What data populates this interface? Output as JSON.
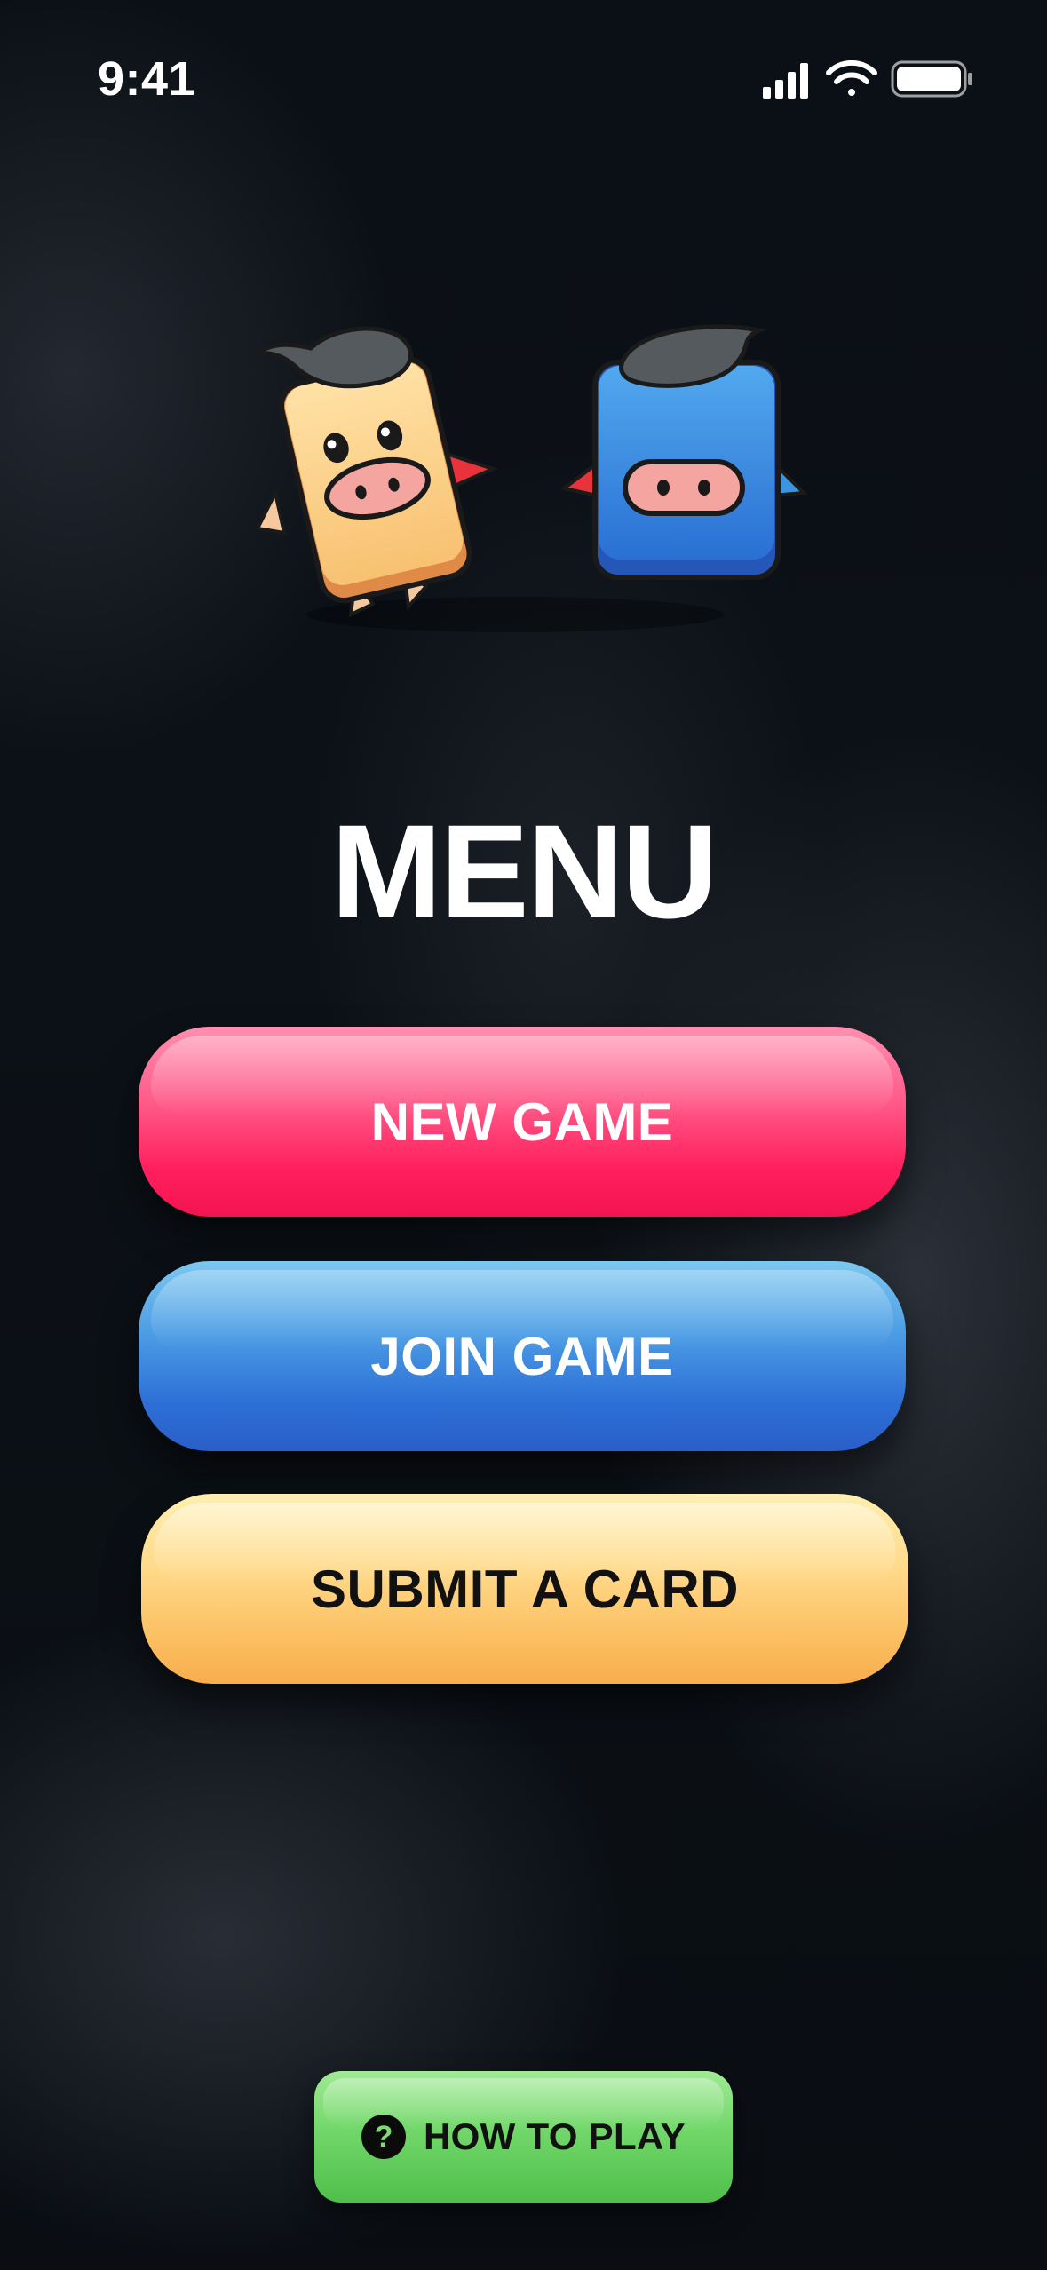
{
  "status_bar": {
    "time": "9:41",
    "icons": [
      "cellular-signal-icon",
      "wifi-icon",
      "battery-icon"
    ]
  },
  "hero": {
    "characters": [
      "orange-pig-card-mascot",
      "blue-pig-card-mascot"
    ]
  },
  "menu": {
    "title": "MENU",
    "buttons": [
      {
        "label": "NEW GAME",
        "color": "#ff1f5e"
      },
      {
        "label": "JOIN GAME",
        "color": "#2d6fd6"
      },
      {
        "label": "SUBMIT A CARD",
        "color": "#fcc062"
      }
    ]
  },
  "footer": {
    "how_to_play_label": "HOW TO PLAY",
    "help_icon_glyph": "?",
    "color": "#4fbf4a"
  }
}
